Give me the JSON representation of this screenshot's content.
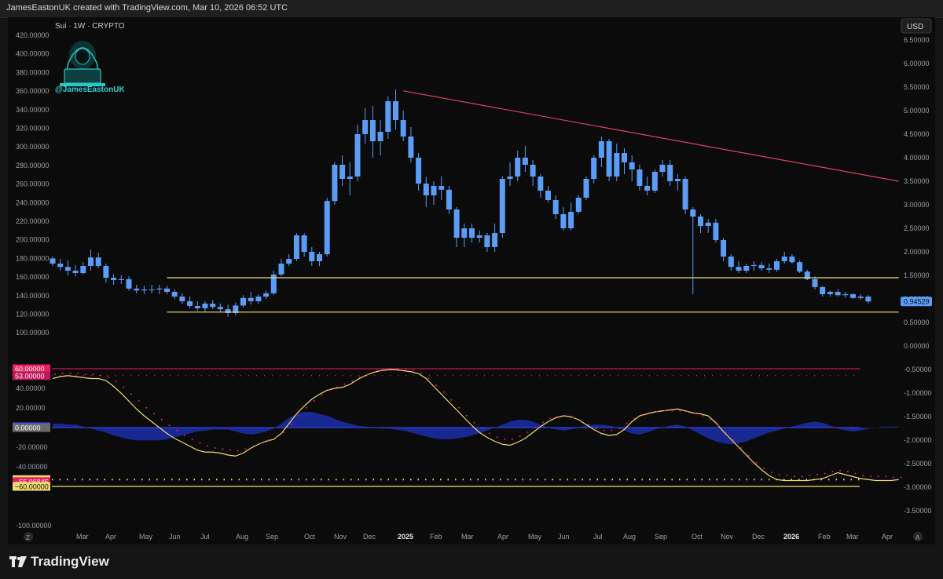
{
  "header": {
    "text": "JamesEastonUK created with TradingView.com, Mar 10, 2026 06:52 UTC"
  },
  "symbol": {
    "text": "Sui · 1W · CRYPTO"
  },
  "watermark": {
    "handle": "@JamesEastonUK"
  },
  "currency_button": {
    "label": "USD"
  },
  "footer": {
    "brand": "TradingView"
  },
  "nav": {
    "left": "Z",
    "right": "A"
  },
  "colors": {
    "up": "#5b9cf6",
    "down": "#5b9cf6",
    "trend_line": "#e0405e",
    "support": "#f0dc6e",
    "osc_line": "#f0dc6e",
    "zero_line": "#3b47ff",
    "histogram": "#1a2fa8",
    "upper_band": "#e91e63"
  },
  "chart_data": [
    {
      "type": "candlestick",
      "title": "Sui · 1W · CRYPTO",
      "price_axis_ticks": [
        "6.50000",
        "6.00000",
        "5.50000",
        "5.00000",
        "4.50000",
        "4.00000",
        "3.50000",
        "3.00000",
        "2.50000",
        "2.00000",
        "1.50000",
        "1.00000",
        "0.50000",
        "0.00000",
        "-0.50000",
        "-1.00000",
        "-1.50000",
        "-2.00000",
        "-2.50000",
        "-3.00000",
        "-3.50000"
      ],
      "price_axis_values": [
        6.5,
        6.0,
        5.5,
        5.0,
        4.5,
        4.0,
        3.5,
        3.0,
        2.5,
        2.0,
        1.5,
        1.0,
        0.5,
        0.0,
        -0.5,
        -1.0,
        -1.5,
        -2.0,
        -2.5,
        -3.0,
        -3.5
      ],
      "last_price": {
        "label": "0.94529",
        "value": 0.94529
      },
      "time_axis_labels": [
        "Mar",
        "Apr",
        "May",
        "Jun",
        "Jul",
        "Aug",
        "Sep",
        "Oct",
        "Nov",
        "Dec",
        "2025",
        "Feb",
        "Mar",
        "Apr",
        "May",
        "Jun",
        "Jul",
        "Aug",
        "Sep",
        "Oct",
        "Nov",
        "Dec",
        "2026",
        "Feb",
        "Mar",
        "Apr"
      ],
      "time_axis_bold": [
        "2025",
        "2026"
      ],
      "candles_ohlc": [
        [
          1.86,
          1.9,
          1.7,
          1.75
        ],
        [
          1.75,
          1.85,
          1.6,
          1.68
        ],
        [
          1.68,
          1.82,
          1.5,
          1.6
        ],
        [
          1.6,
          1.72,
          1.48,
          1.55
        ],
        [
          1.55,
          1.78,
          1.52,
          1.7
        ],
        [
          1.7,
          2.05,
          1.6,
          1.88
        ],
        [
          1.88,
          1.98,
          1.65,
          1.7
        ],
        [
          1.7,
          1.75,
          1.35,
          1.45
        ],
        [
          1.45,
          1.52,
          1.3,
          1.4
        ],
        [
          1.4,
          1.5,
          1.32,
          1.42
        ],
        [
          1.42,
          1.48,
          1.18,
          1.22
        ],
        [
          1.22,
          1.3,
          1.12,
          1.18
        ],
        [
          1.18,
          1.28,
          1.1,
          1.2
        ],
        [
          1.2,
          1.3,
          1.12,
          1.2
        ],
        [
          1.2,
          1.3,
          1.1,
          1.22
        ],
        [
          1.22,
          1.28,
          1.1,
          1.15
        ],
        [
          1.15,
          1.2,
          1.0,
          1.05
        ],
        [
          1.05,
          1.12,
          0.9,
          0.95
        ],
        [
          0.95,
          1.05,
          0.8,
          0.85
        ],
        [
          0.85,
          0.95,
          0.75,
          0.8
        ],
        [
          0.8,
          0.95,
          0.72,
          0.9
        ],
        [
          0.9,
          0.98,
          0.78,
          0.83
        ],
        [
          0.83,
          0.9,
          0.72,
          0.78
        ],
        [
          0.78,
          0.88,
          0.62,
          0.7
        ],
        [
          0.7,
          0.92,
          0.65,
          0.86
        ],
        [
          0.86,
          1.08,
          0.82,
          1.02
        ],
        [
          1.02,
          1.15,
          0.88,
          0.95
        ],
        [
          0.95,
          1.1,
          0.9,
          1.05
        ],
        [
          1.05,
          1.18,
          1.0,
          1.12
        ],
        [
          1.12,
          1.6,
          1.08,
          1.52
        ],
        [
          1.52,
          1.85,
          1.48,
          1.75
        ],
        [
          1.75,
          1.95,
          1.7,
          1.85
        ],
        [
          1.85,
          2.4,
          1.8,
          2.35
        ],
        [
          2.35,
          2.4,
          1.9,
          2.0
        ],
        [
          2.0,
          2.1,
          1.7,
          1.8
        ],
        [
          1.8,
          2.0,
          1.7,
          1.95
        ],
        [
          1.95,
          3.15,
          1.9,
          3.08
        ],
        [
          3.08,
          3.9,
          3.0,
          3.85
        ],
        [
          3.85,
          4.05,
          3.4,
          3.55
        ],
        [
          3.55,
          3.9,
          3.2,
          3.6
        ],
        [
          3.6,
          4.7,
          3.5,
          4.5
        ],
        [
          4.5,
          5.05,
          4.3,
          4.8
        ],
        [
          4.8,
          5.1,
          4.0,
          4.35
        ],
        [
          4.35,
          4.8,
          4.05,
          4.55
        ],
        [
          4.55,
          5.3,
          4.4,
          5.2
        ],
        [
          5.2,
          5.45,
          4.6,
          4.8
        ],
        [
          4.8,
          5.0,
          4.35,
          4.45
        ],
        [
          4.45,
          4.65,
          3.9,
          4.0
        ],
        [
          4.0,
          4.1,
          3.3,
          3.45
        ],
        [
          3.45,
          3.6,
          2.95,
          3.2
        ],
        [
          3.2,
          3.5,
          3.0,
          3.4
        ],
        [
          3.4,
          3.6,
          3.1,
          3.32
        ],
        [
          3.32,
          3.4,
          2.8,
          2.9
        ],
        [
          2.9,
          2.95,
          2.1,
          2.3
        ],
        [
          2.3,
          2.6,
          2.1,
          2.5
        ],
        [
          2.5,
          2.6,
          2.2,
          2.3
        ],
        [
          2.3,
          2.45,
          2.2,
          2.35
        ],
        [
          2.35,
          2.4,
          2.0,
          2.1
        ],
        [
          2.1,
          2.6,
          2.0,
          2.4
        ],
        [
          2.4,
          3.6,
          2.3,
          3.55
        ],
        [
          3.55,
          3.9,
          3.4,
          3.6
        ],
        [
          3.6,
          4.15,
          3.5,
          4.0
        ],
        [
          4.0,
          4.25,
          3.7,
          3.85
        ],
        [
          3.85,
          3.95,
          3.4,
          3.6
        ],
        [
          3.6,
          3.65,
          3.15,
          3.3
        ],
        [
          3.3,
          3.4,
          3.05,
          3.1
        ],
        [
          3.1,
          3.2,
          2.7,
          2.8
        ],
        [
          2.8,
          2.95,
          2.45,
          2.5
        ],
        [
          2.5,
          3.05,
          2.45,
          2.85
        ],
        [
          2.85,
          3.2,
          2.8,
          3.15
        ],
        [
          3.15,
          3.6,
          3.1,
          3.55
        ],
        [
          3.55,
          4.05,
          3.45,
          4.0
        ],
        [
          4.0,
          4.45,
          3.8,
          4.35
        ],
        [
          4.35,
          4.4,
          3.5,
          3.6
        ],
        [
          3.6,
          4.3,
          3.5,
          4.1
        ],
        [
          4.1,
          4.2,
          3.65,
          3.9
        ],
        [
          3.9,
          4.05,
          3.5,
          3.75
        ],
        [
          3.75,
          3.85,
          3.3,
          3.4
        ],
        [
          3.4,
          3.6,
          3.2,
          3.3
        ],
        [
          3.3,
          3.75,
          3.25,
          3.7
        ],
        [
          3.7,
          3.95,
          3.6,
          3.85
        ],
        [
          3.85,
          3.95,
          3.4,
          3.5
        ],
        [
          3.5,
          3.65,
          3.3,
          3.55
        ],
        [
          3.55,
          3.6,
          2.8,
          2.9
        ],
        [
          2.9,
          2.95,
          1.1,
          2.75
        ],
        [
          2.75,
          2.8,
          2.4,
          2.55
        ],
        [
          2.55,
          2.7,
          2.4,
          2.62
        ],
        [
          2.62,
          2.7,
          2.2,
          2.25
        ],
        [
          2.25,
          2.3,
          1.8,
          1.9
        ],
        [
          1.9,
          1.95,
          1.6,
          1.68
        ],
        [
          1.68,
          1.8,
          1.55,
          1.6
        ],
        [
          1.6,
          1.75,
          1.55,
          1.7
        ],
        [
          1.7,
          1.8,
          1.6,
          1.72
        ],
        [
          1.72,
          1.78,
          1.6,
          1.65
        ],
        [
          1.65,
          1.75,
          1.55,
          1.62
        ],
        [
          1.62,
          1.85,
          1.58,
          1.8
        ],
        [
          1.8,
          2.0,
          1.75,
          1.9
        ],
        [
          1.9,
          1.95,
          1.75,
          1.78
        ],
        [
          1.78,
          1.82,
          1.55,
          1.58
        ],
        [
          1.58,
          1.62,
          1.4,
          1.42
        ],
        [
          1.42,
          1.48,
          1.2,
          1.25
        ],
        [
          1.25,
          1.28,
          1.05,
          1.1
        ],
        [
          1.1,
          1.18,
          1.05,
          1.15
        ],
        [
          1.15,
          1.2,
          1.05,
          1.08
        ],
        [
          1.08,
          1.15,
          1.02,
          1.1
        ],
        [
          1.1,
          1.12,
          1.0,
          1.02
        ],
        [
          1.02,
          1.1,
          0.98,
          1.05
        ],
        [
          1.05,
          1.08,
          0.9,
          0.94529
        ]
      ],
      "annotations": [
        {
          "kind": "trend_line",
          "from": [
            46,
            5.42
          ],
          "to": [
            111,
            3.5
          ]
        },
        {
          "kind": "support_line",
          "from": [
            15,
            1.45
          ],
          "to": [
            111,
            1.45
          ]
        },
        {
          "kind": "support_line",
          "from": [
            15,
            0.72
          ],
          "to": [
            111,
            0.72
          ]
        }
      ]
    },
    {
      "type": "line",
      "name": "oscillator",
      "y_axis_ticks": [
        "40.00000",
        "20.00000",
        "-20.00000",
        "-40.00000",
        "-100.00000"
      ],
      "y_axis_values": [
        40,
        20,
        -20,
        -40,
        -100
      ],
      "level_labels": [
        {
          "label": "60.00000",
          "value": 60,
          "bg": "#e91e63"
        },
        {
          "label": "53.00000",
          "value": 53,
          "bg": "#c2185b"
        },
        {
          "label": "0.96911",
          "value": 0.96911,
          "bg": "#2b3bff"
        },
        {
          "label": "0.00000",
          "value": 0,
          "bg": "#6b6b6b"
        },
        {
          "label": "−53.00000",
          "value": -53,
          "bg": "#f0dc6e"
        },
        {
          "label": "−54.09934",
          "value": -54.09934,
          "bg": "#f0dc6e"
        },
        {
          "label": "−55.06845",
          "value": -55.06845,
          "bg": "#e91e63"
        },
        {
          "label": "−60.00000",
          "value": -60,
          "bg": "#f0dc6e"
        }
      ],
      "levels": [
        60,
        53,
        0,
        -53,
        -60
      ],
      "line_values": [
        50,
        52,
        53,
        52,
        51,
        50,
        50,
        48,
        42,
        35,
        27,
        19,
        12,
        6,
        0,
        -6,
        -11,
        -15,
        -19,
        -23,
        -25,
        -25,
        -26,
        -28,
        -29,
        -26,
        -21,
        -17,
        -14,
        -12,
        -6,
        4,
        14,
        22,
        29,
        34,
        38,
        40,
        41,
        44,
        49,
        53,
        56,
        58,
        59,
        59,
        58,
        57,
        55,
        50,
        42,
        34,
        26,
        18,
        10,
        2,
        -5,
        -10,
        -14,
        -17,
        -18,
        -15,
        -11,
        -5,
        1,
        6,
        10,
        12,
        11,
        8,
        3,
        -2,
        -6,
        -8,
        -7,
        -2,
        6,
        12,
        14,
        16,
        17,
        18,
        19,
        17,
        15,
        14,
        12,
        5,
        -4,
        -12,
        -20,
        -28,
        -36,
        -43,
        -49,
        -53,
        -54,
        -54,
        -54,
        -54,
        -53,
        -52,
        -49,
        -46,
        -48,
        -50,
        -52,
        -53,
        -54,
        -54,
        -54,
        -53
      ],
      "signal_values": [
        51,
        52,
        52,
        52,
        51,
        51,
        50,
        48,
        44,
        38,
        31,
        24,
        17,
        11,
        5,
        -1,
        -6,
        -11,
        -15,
        -19,
        -22,
        -24,
        -25,
        -26,
        -27,
        -25,
        -22,
        -19,
        -16,
        -13,
        -8,
        0,
        9,
        17,
        24,
        30,
        35,
        38,
        41,
        44,
        48,
        51,
        54,
        56,
        57,
        57,
        56,
        55,
        52,
        47,
        40,
        33,
        25,
        17,
        9,
        2,
        -4,
        -9,
        -13,
        -15,
        -15,
        -12,
        -8,
        -3,
        2,
        6,
        8,
        9,
        7,
        4,
        0,
        -4,
        -6,
        -6,
        -4,
        1,
        6,
        10,
        12,
        13,
        14,
        14,
        14,
        13,
        11,
        9,
        5,
        -1,
        -8,
        -16,
        -24,
        -32,
        -39,
        -45,
        -49,
        -51,
        -52,
        -53,
        -53,
        -52,
        -51,
        -50,
        -48,
        -47,
        -48,
        -50,
        -52,
        -53,
        -53,
        -53,
        -54,
        -54
      ],
      "histogram_values": [
        4,
        4,
        3,
        3,
        1,
        -1,
        -3,
        -5,
        -8,
        -10,
        -12,
        -13,
        -13,
        -13,
        -13,
        -12,
        -10,
        -8,
        -6,
        -4,
        -3,
        -2,
        -2,
        -2,
        -4,
        -6,
        -7,
        -6,
        -4,
        -1,
        4,
        10,
        14,
        16,
        16,
        14,
        12,
        9,
        6,
        4,
        2,
        1,
        0,
        -1,
        -1,
        -2,
        -3,
        -5,
        -7,
        -9,
        -11,
        -12,
        -12,
        -11,
        -10,
        -8,
        -6,
        -3,
        0,
        3,
        6,
        8,
        8,
        6,
        3,
        0,
        -2,
        -3,
        -2,
        0,
        2,
        3,
        3,
        2,
        0,
        -3,
        -6,
        -7,
        -5,
        -2,
        0,
        2,
        3,
        1,
        -3,
        -7,
        -11,
        -14,
        -16,
        -17,
        -16,
        -14,
        -11,
        -8,
        -5,
        -3,
        -1,
        1,
        3,
        5,
        6,
        5,
        2,
        -1,
        -3,
        -4,
        -3,
        -1,
        0,
        1,
        1,
        1
      ]
    }
  ]
}
